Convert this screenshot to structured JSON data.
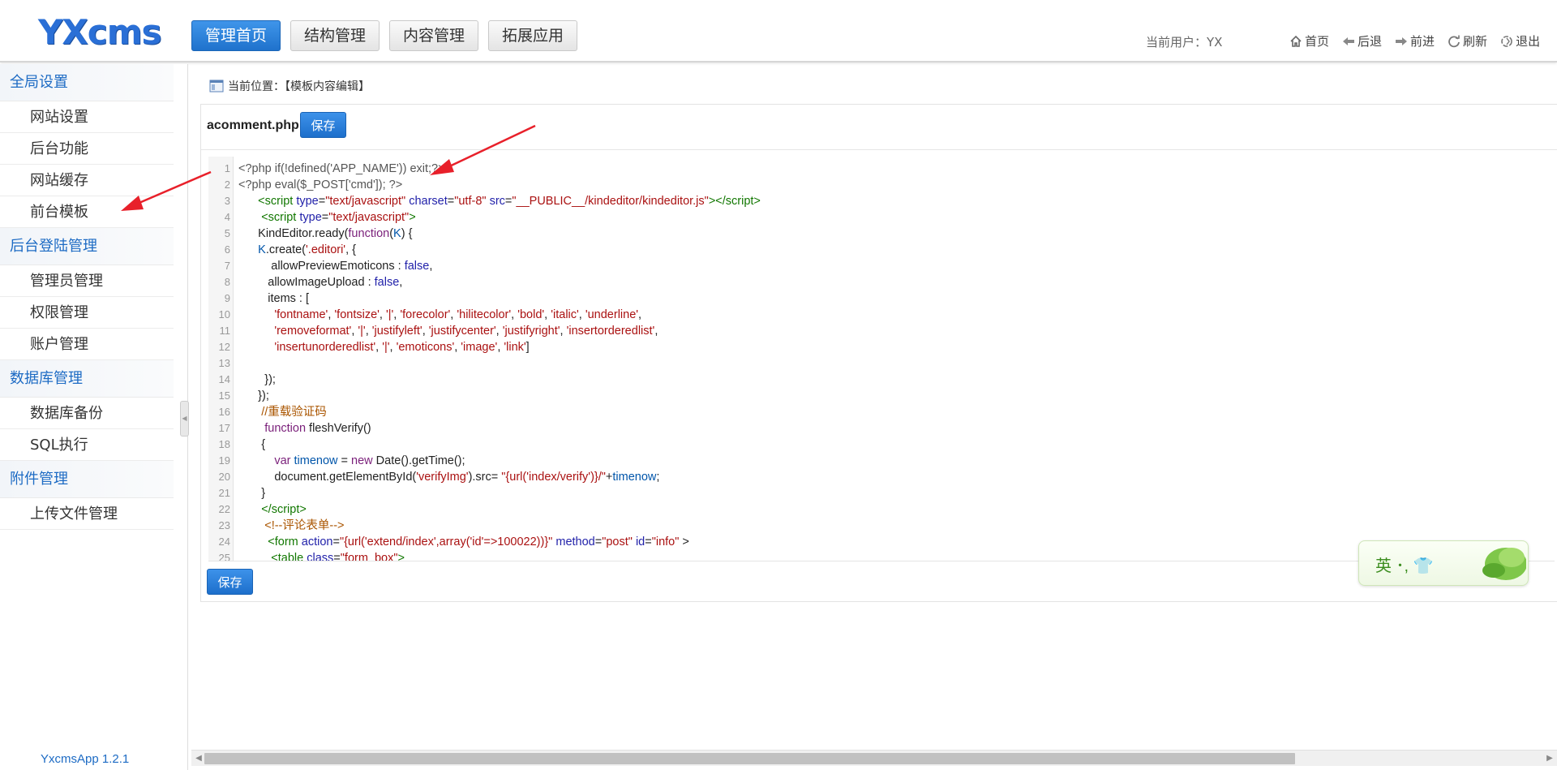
{
  "header": {
    "logo": "YXcms",
    "nav": [
      {
        "label": "管理首页",
        "active": true
      },
      {
        "label": "结构管理",
        "active": false
      },
      {
        "label": "内容管理",
        "active": false
      },
      {
        "label": "拓展应用",
        "active": false
      }
    ],
    "current_user": "当前用户：YX",
    "tools": [
      {
        "label": "首页",
        "icon": "home-icon"
      },
      {
        "label": "后退",
        "icon": "back-arrow-icon"
      },
      {
        "label": "前进",
        "icon": "forward-arrow-icon"
      },
      {
        "label": "刷新",
        "icon": "refresh-icon"
      },
      {
        "label": "退出",
        "icon": "logout-icon"
      }
    ]
  },
  "sidebar": {
    "sections": [
      {
        "title": "全局设置",
        "items": [
          "网站设置",
          "后台功能",
          "网站缓存",
          "前台模板"
        ]
      },
      {
        "title": "后台登陆管理",
        "items": [
          "管理员管理",
          "权限管理",
          "账户管理"
        ]
      },
      {
        "title": "数据库管理",
        "items": [
          "数据库备份",
          "SQL执行"
        ]
      },
      {
        "title": "附件管理",
        "items": [
          "上传文件管理"
        ]
      }
    ],
    "version": "YxcmsApp 1.2.1"
  },
  "main": {
    "breadcrumb": "当前位置：【模板内容编辑】",
    "filename": "acomment.php",
    "save_label": "保存"
  },
  "code_lines": [
    "1",
    "2",
    "3",
    "4",
    "5",
    "6",
    "7",
    "8",
    "9",
    "10",
    "11",
    "12",
    "13",
    "14",
    "15",
    "16",
    "17",
    "18",
    "19",
    "20",
    "21",
    "22",
    "23",
    "24",
    "25"
  ],
  "ime": {
    "label": "英 ･, 👕"
  },
  "colors": {
    "accent": "#2a6fd6",
    "arrow": "#e8202a"
  }
}
